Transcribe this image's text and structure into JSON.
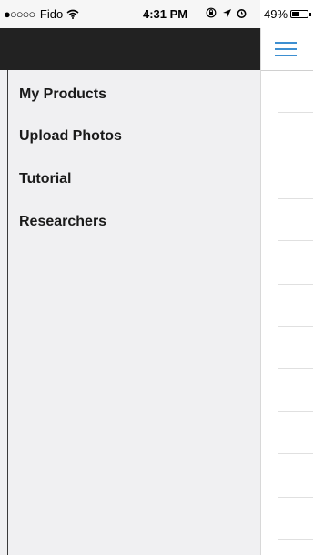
{
  "status_bar": {
    "carrier": "Fido",
    "signal_dots": "●○○○○",
    "time": "4:31 PM",
    "battery": "49%",
    "battery_level": 0.49
  },
  "drawer": {
    "items": [
      {
        "label": "My Products"
      },
      {
        "label": "Upload Photos"
      },
      {
        "label": "Tutorial"
      },
      {
        "label": "Researchers"
      }
    ]
  },
  "colors": {
    "drawer_header": "#222222",
    "drawer_background": "#f0f0f2",
    "hamburger_accent": "#3d8fd1"
  }
}
